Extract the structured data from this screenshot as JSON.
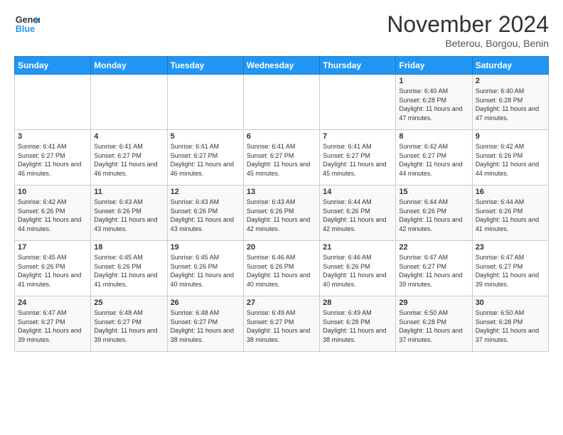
{
  "logo": {
    "line1": "General",
    "line2": "Blue"
  },
  "title": "November 2024",
  "location": "Beterou, Borgou, Benin",
  "weekdays": [
    "Sunday",
    "Monday",
    "Tuesday",
    "Wednesday",
    "Thursday",
    "Friday",
    "Saturday"
  ],
  "weeks": [
    [
      {
        "day": "",
        "info": ""
      },
      {
        "day": "",
        "info": ""
      },
      {
        "day": "",
        "info": ""
      },
      {
        "day": "",
        "info": ""
      },
      {
        "day": "",
        "info": ""
      },
      {
        "day": "1",
        "info": "Sunrise: 6:40 AM\nSunset: 6:28 PM\nDaylight: 11 hours and 47 minutes."
      },
      {
        "day": "2",
        "info": "Sunrise: 6:40 AM\nSunset: 6:28 PM\nDaylight: 11 hours and 47 minutes."
      }
    ],
    [
      {
        "day": "3",
        "info": "Sunrise: 6:41 AM\nSunset: 6:27 PM\nDaylight: 11 hours and 46 minutes."
      },
      {
        "day": "4",
        "info": "Sunrise: 6:41 AM\nSunset: 6:27 PM\nDaylight: 11 hours and 46 minutes."
      },
      {
        "day": "5",
        "info": "Sunrise: 6:41 AM\nSunset: 6:27 PM\nDaylight: 11 hours and 46 minutes."
      },
      {
        "day": "6",
        "info": "Sunrise: 6:41 AM\nSunset: 6:27 PM\nDaylight: 11 hours and 45 minutes."
      },
      {
        "day": "7",
        "info": "Sunrise: 6:41 AM\nSunset: 6:27 PM\nDaylight: 11 hours and 45 minutes."
      },
      {
        "day": "8",
        "info": "Sunrise: 6:42 AM\nSunset: 6:27 PM\nDaylight: 11 hours and 44 minutes."
      },
      {
        "day": "9",
        "info": "Sunrise: 6:42 AM\nSunset: 6:26 PM\nDaylight: 11 hours and 44 minutes."
      }
    ],
    [
      {
        "day": "10",
        "info": "Sunrise: 6:42 AM\nSunset: 6:26 PM\nDaylight: 11 hours and 44 minutes."
      },
      {
        "day": "11",
        "info": "Sunrise: 6:43 AM\nSunset: 6:26 PM\nDaylight: 11 hours and 43 minutes."
      },
      {
        "day": "12",
        "info": "Sunrise: 6:43 AM\nSunset: 6:26 PM\nDaylight: 11 hours and 43 minutes."
      },
      {
        "day": "13",
        "info": "Sunrise: 6:43 AM\nSunset: 6:26 PM\nDaylight: 11 hours and 42 minutes."
      },
      {
        "day": "14",
        "info": "Sunrise: 6:44 AM\nSunset: 6:26 PM\nDaylight: 11 hours and 42 minutes."
      },
      {
        "day": "15",
        "info": "Sunrise: 6:44 AM\nSunset: 6:26 PM\nDaylight: 11 hours and 42 minutes."
      },
      {
        "day": "16",
        "info": "Sunrise: 6:44 AM\nSunset: 6:26 PM\nDaylight: 11 hours and 41 minutes."
      }
    ],
    [
      {
        "day": "17",
        "info": "Sunrise: 6:45 AM\nSunset: 6:26 PM\nDaylight: 11 hours and 41 minutes."
      },
      {
        "day": "18",
        "info": "Sunrise: 6:45 AM\nSunset: 6:26 PM\nDaylight: 11 hours and 41 minutes."
      },
      {
        "day": "19",
        "info": "Sunrise: 6:45 AM\nSunset: 6:26 PM\nDaylight: 11 hours and 40 minutes."
      },
      {
        "day": "20",
        "info": "Sunrise: 6:46 AM\nSunset: 6:26 PM\nDaylight: 11 hours and 40 minutes."
      },
      {
        "day": "21",
        "info": "Sunrise: 6:46 AM\nSunset: 6:26 PM\nDaylight: 11 hours and 40 minutes."
      },
      {
        "day": "22",
        "info": "Sunrise: 6:47 AM\nSunset: 6:27 PM\nDaylight: 11 hours and 39 minutes."
      },
      {
        "day": "23",
        "info": "Sunrise: 6:47 AM\nSunset: 6:27 PM\nDaylight: 11 hours and 39 minutes."
      }
    ],
    [
      {
        "day": "24",
        "info": "Sunrise: 6:47 AM\nSunset: 6:27 PM\nDaylight: 11 hours and 39 minutes."
      },
      {
        "day": "25",
        "info": "Sunrise: 6:48 AM\nSunset: 6:27 PM\nDaylight: 11 hours and 39 minutes."
      },
      {
        "day": "26",
        "info": "Sunrise: 6:48 AM\nSunset: 6:27 PM\nDaylight: 11 hours and 38 minutes."
      },
      {
        "day": "27",
        "info": "Sunrise: 6:49 AM\nSunset: 6:27 PM\nDaylight: 11 hours and 38 minutes."
      },
      {
        "day": "28",
        "info": "Sunrise: 6:49 AM\nSunset: 6:28 PM\nDaylight: 11 hours and 38 minutes."
      },
      {
        "day": "29",
        "info": "Sunrise: 6:50 AM\nSunset: 6:28 PM\nDaylight: 11 hours and 37 minutes."
      },
      {
        "day": "30",
        "info": "Sunrise: 6:50 AM\nSunset: 6:28 PM\nDaylight: 11 hours and 37 minutes."
      }
    ]
  ]
}
